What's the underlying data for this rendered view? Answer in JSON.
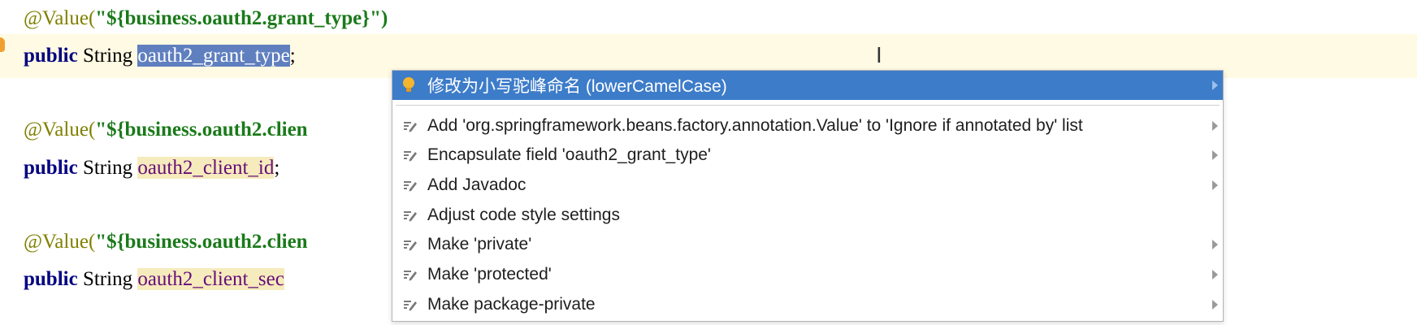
{
  "code": {
    "line1": {
      "annotation": "@Value(",
      "quote_open": "\"",
      "string": "${business.oauth2.grant_type}",
      "quote_close": "\")"
    },
    "line2": {
      "keyword": "public",
      "type": " String ",
      "identifier": "oauth2_grant_type",
      "semicolon": ";"
    },
    "line3": {
      "annotation": "@Value(",
      "quote_open": "\"",
      "string": "${business.oauth2.clien"
    },
    "line4": {
      "keyword": "public",
      "type": " String ",
      "identifier": "oauth2_client_id",
      "semicolon": ";"
    },
    "line5": {
      "annotation": "@Value(",
      "quote_open": "\"",
      "string": "${business.oauth2.clien"
    },
    "line6": {
      "keyword": "public",
      "type": " String ",
      "identifier": "oauth2_client_sec"
    }
  },
  "intention_popup": {
    "items": [
      {
        "icon": "bulb-icon",
        "label": "修改为小写驼峰命名 (lowerCamelCase)",
        "selected": true,
        "has_submenu": true
      },
      {
        "icon": "edit-icon",
        "label": "Add 'org.springframework.beans.factory.annotation.Value' to 'Ignore if annotated by' list",
        "has_submenu": true
      },
      {
        "icon": "edit-icon",
        "label": "Encapsulate field 'oauth2_grant_type'",
        "has_submenu": true
      },
      {
        "icon": "edit-icon",
        "label": "Add Javadoc",
        "has_submenu": true
      },
      {
        "icon": "edit-icon",
        "label": "Adjust code style settings",
        "has_submenu": false
      },
      {
        "icon": "edit-icon",
        "label": "Make 'private'",
        "has_submenu": true
      },
      {
        "icon": "edit-icon",
        "label": "Make 'protected'",
        "has_submenu": true
      },
      {
        "icon": "edit-icon",
        "label": "Make package-private",
        "has_submenu": true
      }
    ]
  },
  "colors": {
    "selection": "#5f7fbf",
    "popup_selected": "#3d7cc9",
    "caret_row": "#fffae3",
    "usage_highlight": "#f6ebbc"
  }
}
